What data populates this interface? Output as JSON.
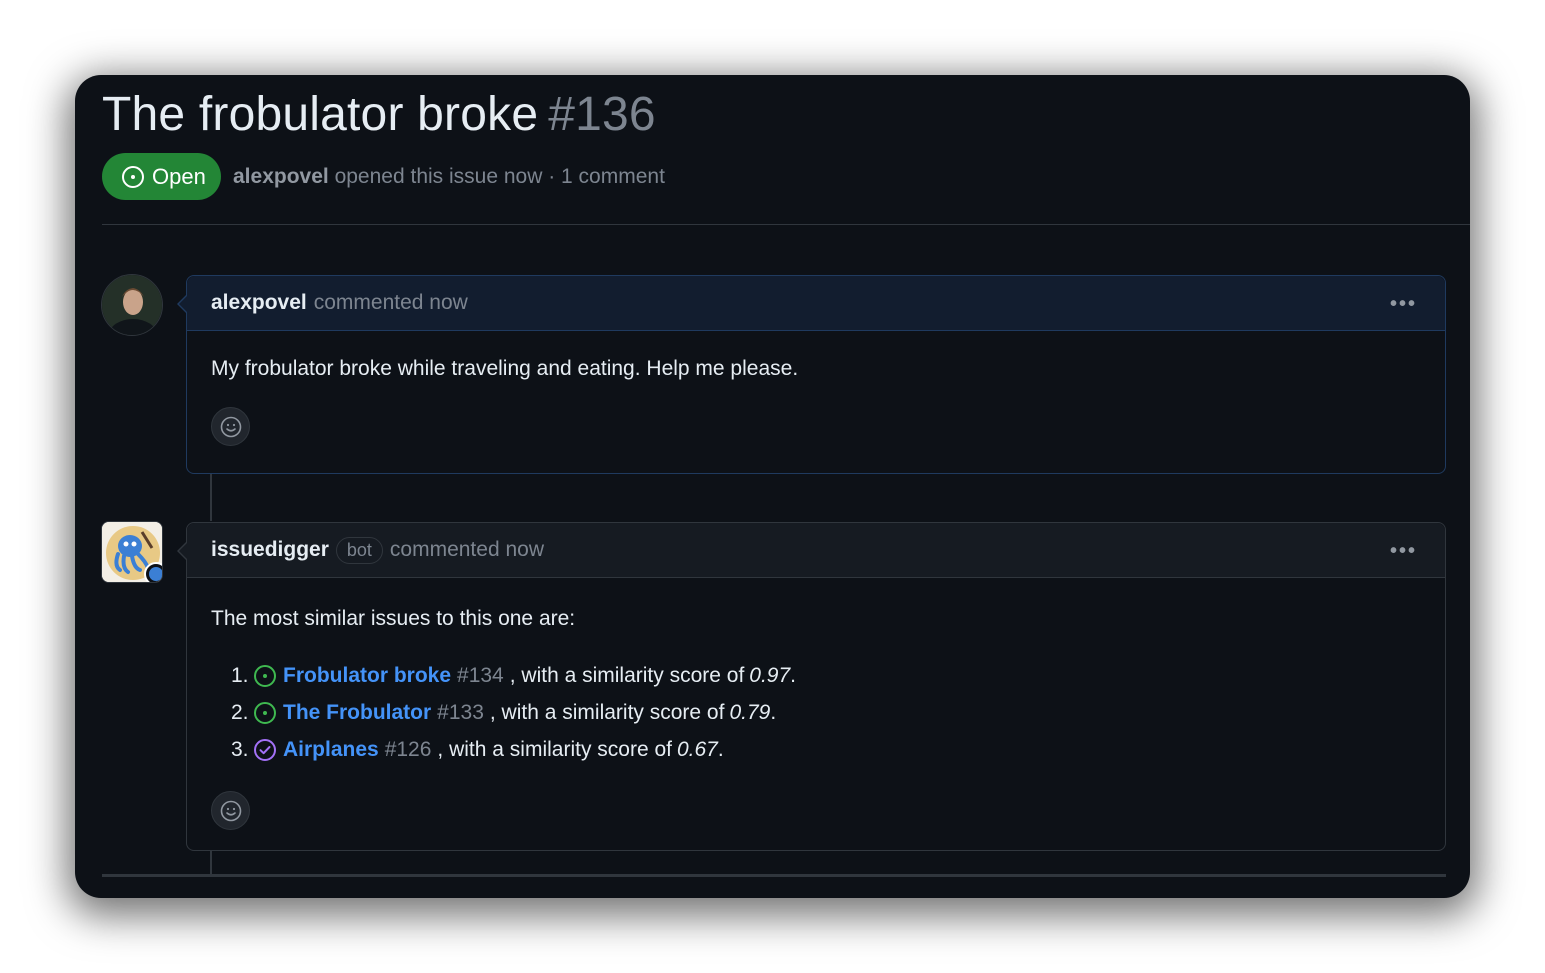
{
  "issue": {
    "title": "The frobulator broke",
    "number": "#136",
    "state": "Open",
    "author": "alexpovel",
    "meta": "opened this issue now · 1 comment"
  },
  "comments": [
    {
      "author": "alexpovel",
      "action": "commented now",
      "body": "My frobulator broke while traveling and eating. Help me please.",
      "more_icon": "kebab-horizontal-icon",
      "reaction_icon": "smiley-icon"
    },
    {
      "author": "issuedigger",
      "badge": "bot",
      "action": "commented now",
      "intro": "The most similar issues to this one are:",
      "more_icon": "kebab-horizontal-icon",
      "reaction_icon": "smiley-icon",
      "similar": [
        {
          "index": "1.",
          "state": "open",
          "title": "Frobulator broke",
          "ref": "#134",
          "text": ", with a similarity score of",
          "score": "0.97"
        },
        {
          "index": "2.",
          "state": "open",
          "title": "The Frobulator",
          "ref": "#133",
          "text": ", with a similarity score of",
          "score": "0.79"
        },
        {
          "index": "3.",
          "state": "closed",
          "title": "Airplanes",
          "ref": "#126",
          "text": ", with a similarity score of",
          "score": "0.67"
        }
      ]
    }
  ],
  "colors": {
    "background": "#0d1117",
    "open_green": "#238636",
    "open_icon": "#3fb950",
    "closed_purple": "#a371f7",
    "link_blue": "#4493f8"
  }
}
